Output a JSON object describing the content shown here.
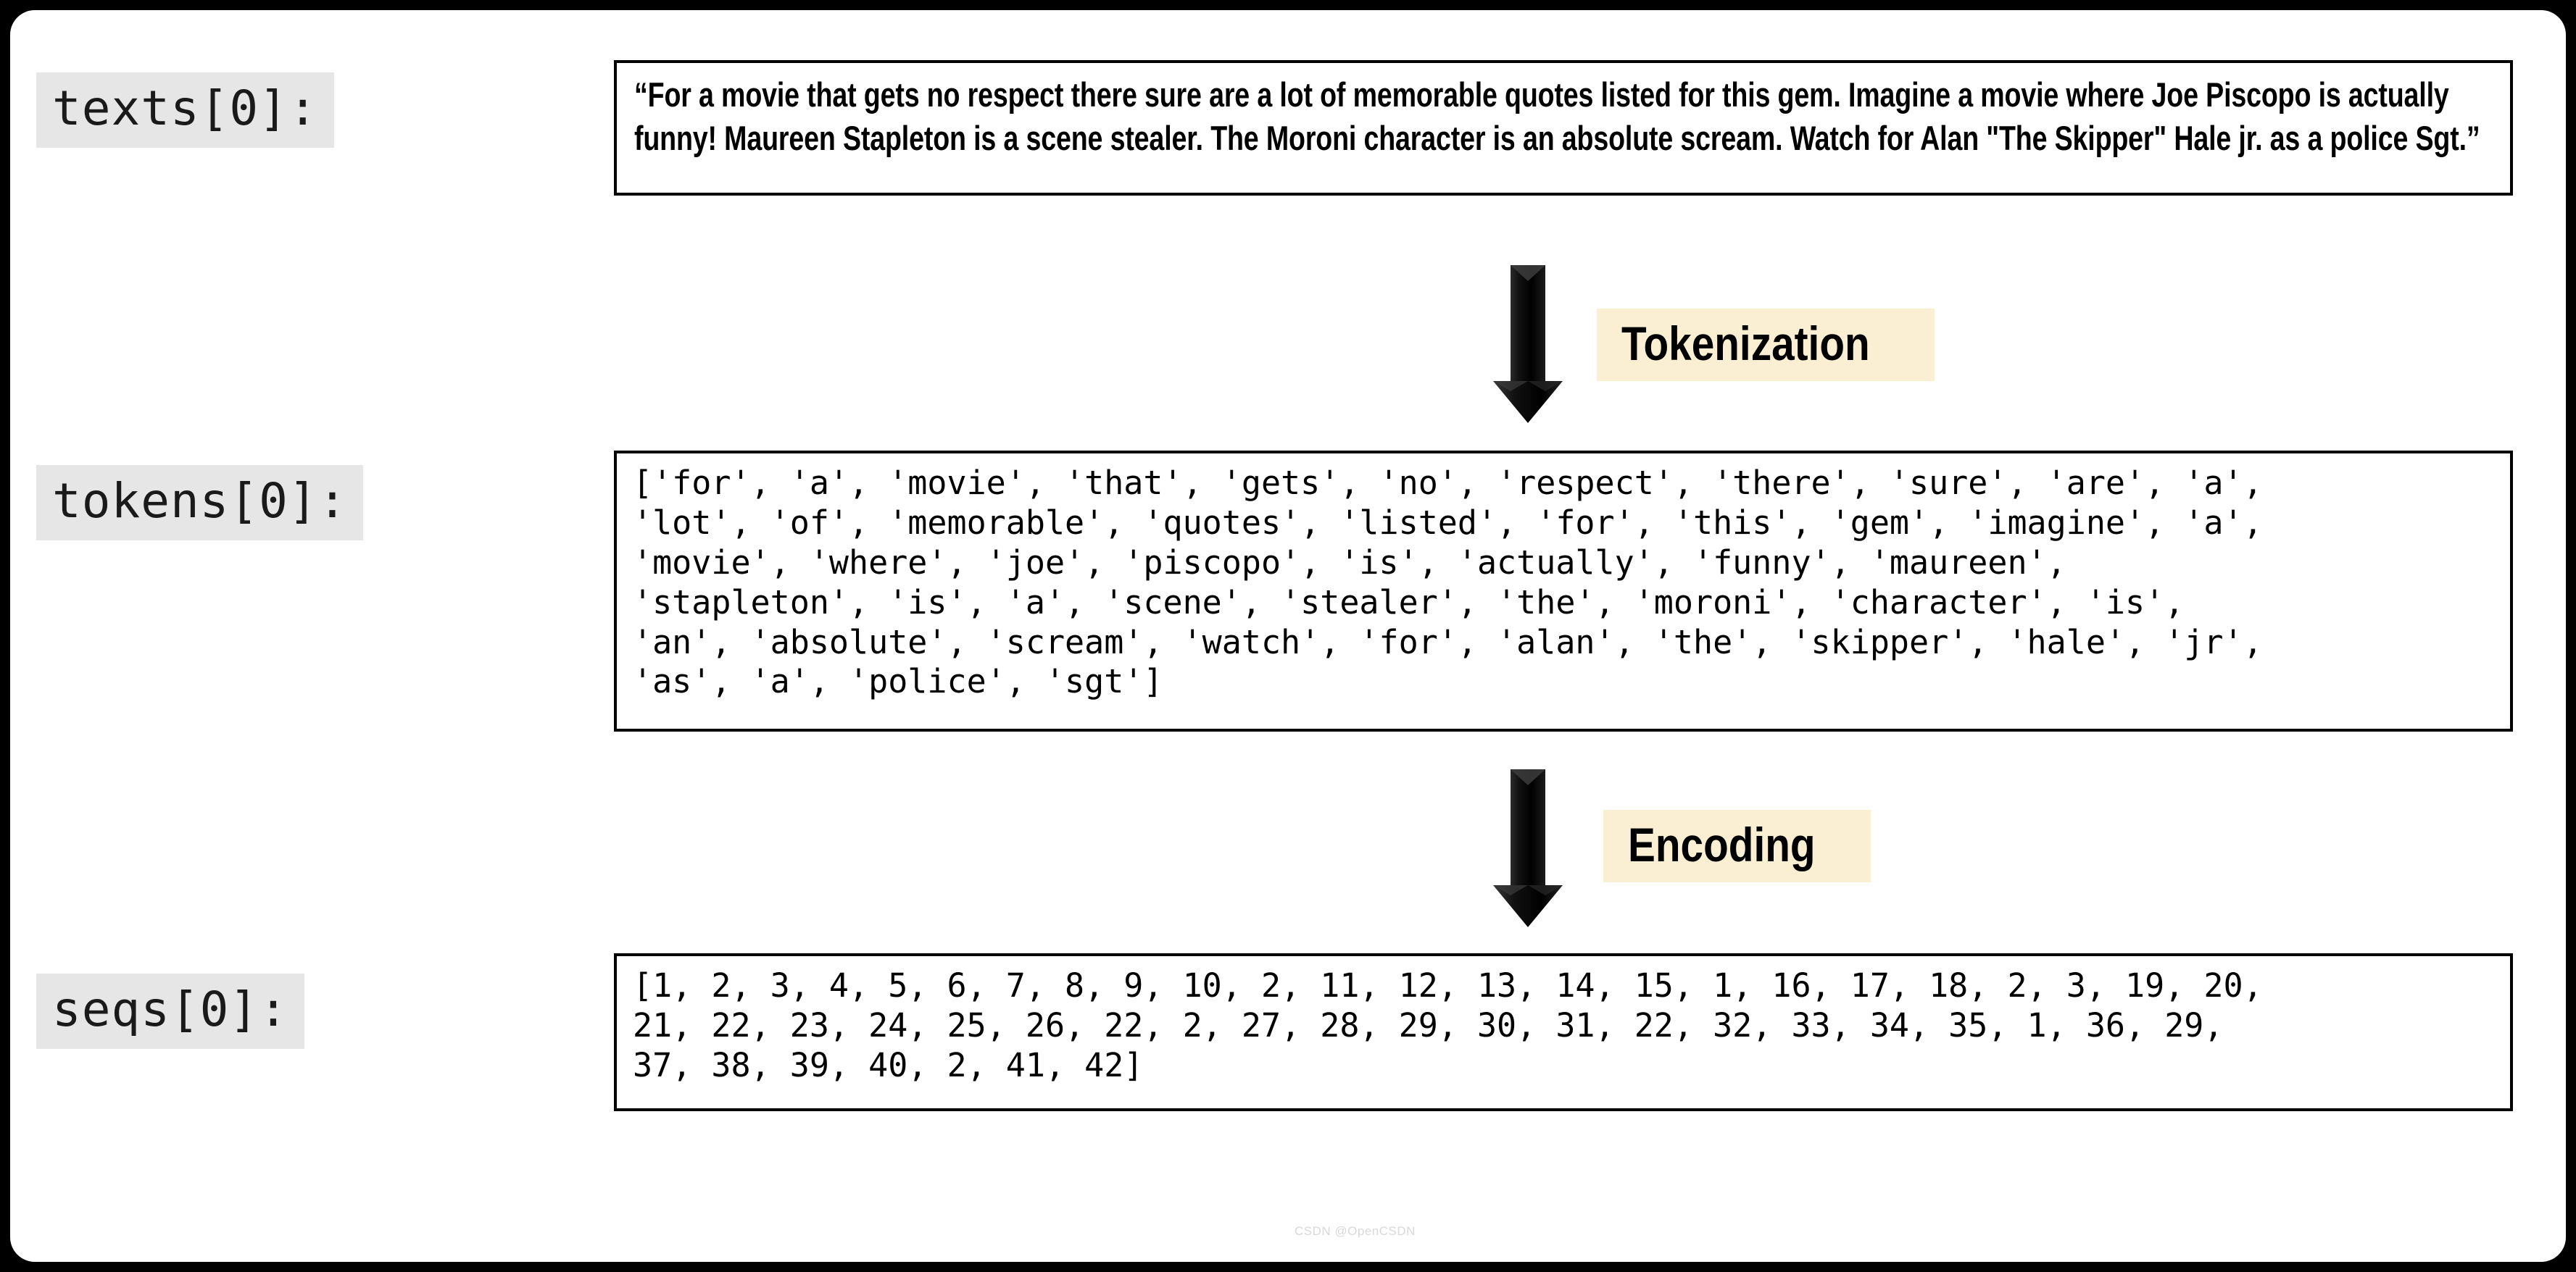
{
  "slide": {
    "background_color": "#000000",
    "surface_color": "#ffffff"
  },
  "labels": {
    "texts": "texts[0]:",
    "tokens": "tokens[0]:",
    "seqs": "seqs[0]:",
    "highlight_color": "#e6e6e6"
  },
  "text_sample": {
    "content": "“For a movie that gets no respect there sure are a lot of memorable quotes listed for this gem. Imagine a movie where Joe Piscopo is actually funny! Maureen Stapleton is a scene stealer. The Moroni character is an absolute scream. Watch for Alan \"The Skipper\" Hale jr. as a police Sgt.”"
  },
  "tokens_sample": {
    "content": "['for', 'a', 'movie', 'that', 'gets', 'no', 'respect', 'there', 'sure', 'are', 'a',\n'lot', 'of', 'memorable', 'quotes', 'listed', 'for', 'this', 'gem', 'imagine', 'a',\n'movie', 'where', 'joe', 'piscopo', 'is', 'actually', 'funny', 'maureen',\n'stapleton', 'is', 'a', 'scene', 'stealer', 'the', 'moroni', 'character', 'is',\n'an', 'absolute', 'scream', 'watch', 'for', 'alan', 'the', 'skipper', 'hale', 'jr',\n'as', 'a', 'police', 'sgt']",
    "tokens": [
      "for",
      "a",
      "movie",
      "that",
      "gets",
      "no",
      "respect",
      "there",
      "sure",
      "are",
      "a",
      "lot",
      "of",
      "memorable",
      "quotes",
      "listed",
      "for",
      "this",
      "gem",
      "imagine",
      "a",
      "movie",
      "where",
      "joe",
      "piscopo",
      "is",
      "actually",
      "funny",
      "maureen",
      "stapleton",
      "is",
      "a",
      "scene",
      "stealer",
      "the",
      "moroni",
      "character",
      "is",
      "an",
      "absolute",
      "scream",
      "watch",
      "for",
      "alan",
      "the",
      "skipper",
      "hale",
      "jr",
      "as",
      "a",
      "police",
      "sgt"
    ]
  },
  "seqs_sample": {
    "content": "[1, 2, 3, 4, 5, 6, 7, 8, 9, 10, 2, 11, 12, 13, 14, 15, 1, 16, 17, 18, 2, 3, 19, 20,\n21, 22, 23, 24, 25, 26, 22, 2, 27, 28, 29, 30, 31, 22, 32, 33, 34, 35, 1, 36, 29,\n37, 38, 39, 40, 2, 41, 42]",
    "ids": [
      1,
      2,
      3,
      4,
      5,
      6,
      7,
      8,
      9,
      10,
      2,
      11,
      12,
      13,
      14,
      15,
      1,
      16,
      17,
      18,
      2,
      3,
      19,
      20,
      21,
      22,
      23,
      24,
      25,
      26,
      22,
      2,
      27,
      28,
      29,
      30,
      31,
      22,
      32,
      33,
      34,
      35,
      1,
      36,
      29,
      37,
      38,
      39,
      40,
      2,
      41,
      42
    ]
  },
  "steps": {
    "tokenization": {
      "label": "Tokenization",
      "badge_color": "#faefd3",
      "arrow_icon": "down-block-arrow-icon"
    },
    "encoding": {
      "label": "Encoding",
      "badge_color": "#faefd3",
      "arrow_icon": "down-block-arrow-icon"
    }
  },
  "watermark": {
    "text": "CSDN @OpenCSDN"
  }
}
